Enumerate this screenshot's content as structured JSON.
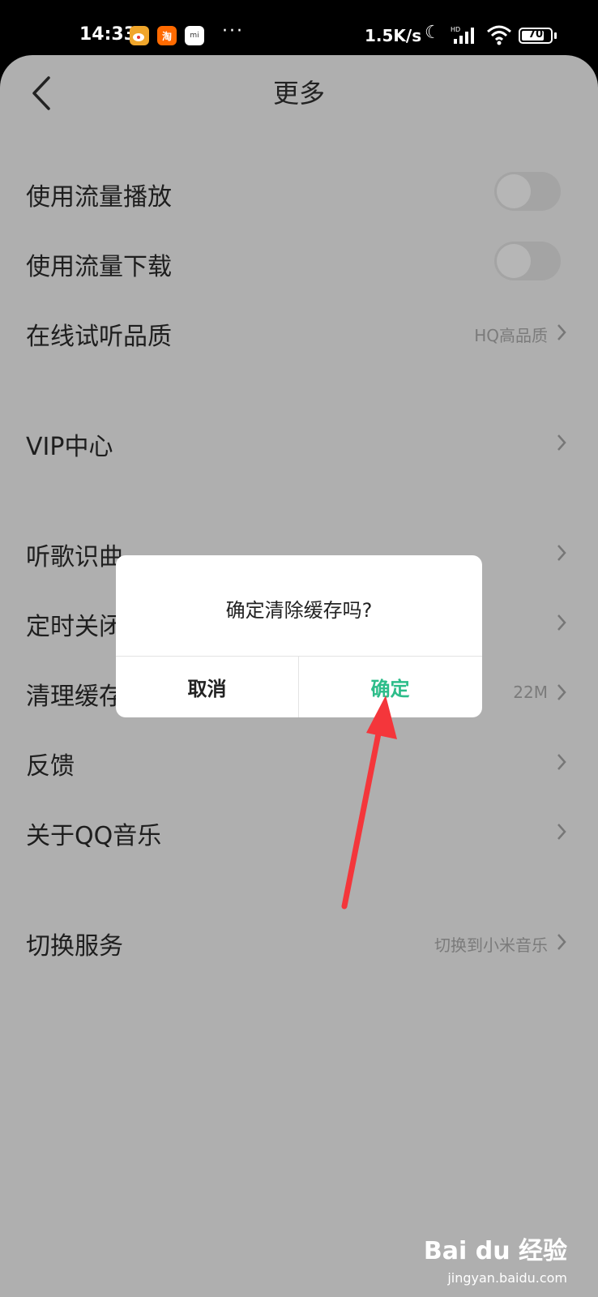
{
  "status_bar": {
    "time": "14:33",
    "apps": [
      "weibo-icon",
      "taobao-icon",
      "mi-icon"
    ],
    "taobao_glyph": "淘",
    "mi_glyph": "mi",
    "dots": "···",
    "net_speed": "1.5K/s",
    "battery": "70"
  },
  "header": {
    "title": "更多"
  },
  "settings": {
    "mobile_play": "使用流量播放",
    "mobile_download": "使用流量下载",
    "quality_label": "在线试听品质",
    "quality_value": "HQ高品质",
    "vip_label": "VIP中心",
    "song_recog": "听歌识曲",
    "timer": "定时关闭",
    "clear_cache": "清理缓存",
    "cache_size": "22M",
    "feedback": "反馈",
    "about": "关于QQ音乐",
    "switch_service": "切换服务",
    "switch_value": "切换到小米音乐"
  },
  "dialog": {
    "message": "确定清除缓存吗?",
    "cancel": "取消",
    "confirm": "确定",
    "confirm_color": "#2dbd8a"
  },
  "watermark": {
    "brand": "Bai du 经验",
    "url": "jingyan.baidu.com"
  }
}
